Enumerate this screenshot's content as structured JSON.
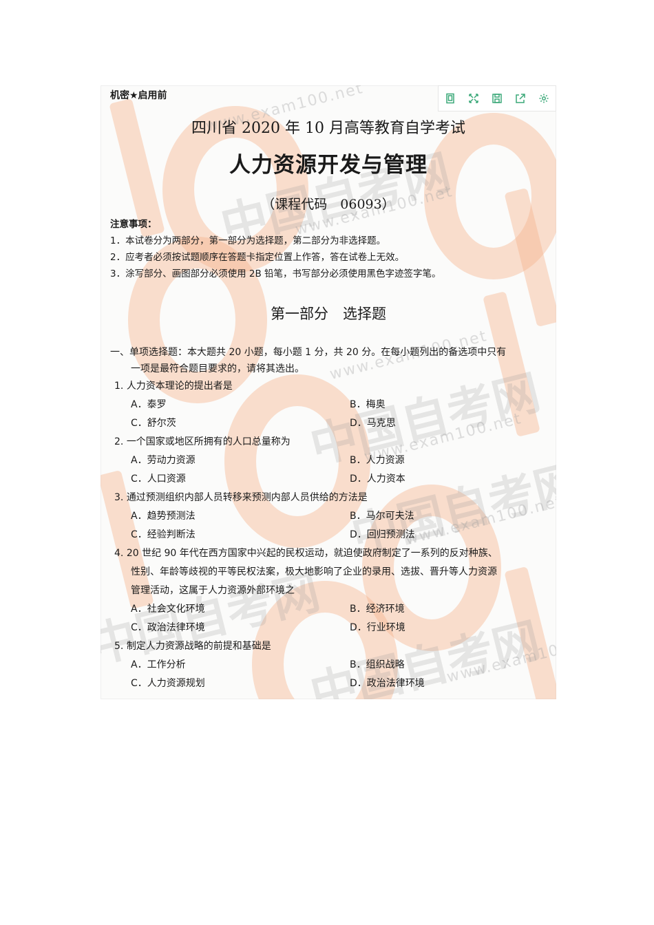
{
  "header": {
    "secret_mark": "机密★启用前",
    "exam_title": "四川省 2020 年 10 月高等教育自学考试",
    "course_name": "人力资源开发与管理",
    "course_code": "（课程代码　06093）"
  },
  "toolbar": {
    "icons": [
      "page-icon",
      "fullscreen-icon",
      "save-icon",
      "share-icon",
      "settings-icon"
    ],
    "accent": "#3aa878"
  },
  "notes": {
    "heading": "注意事项：",
    "items": [
      "1．本试卷分为两部分，第一部分为选择题，第二部分为非选择题。",
      "2．应考者必须按试题顺序在答题卡指定位置上作答，答在试卷上无效。",
      "3．涂写部分、画图部分必须使用 2B 铅笔，书写部分必须使用黑色字迹签字笔。"
    ]
  },
  "part_title": "第一部分　选择题",
  "section": {
    "line1": "一、单项选择题：本大题共 20 小题，每小题 1 分，共 20 分。在每小题列出的备选项中只有",
    "line2": "一项是最符合题目要求的，请将其选出。"
  },
  "questions": [
    {
      "num": "1.",
      "stem": "人力资本理论的提出者是",
      "A": "A．泰罗",
      "B": "B．梅奥",
      "C": "C．舒尔茨",
      "D": "D．马克思"
    },
    {
      "num": "2.",
      "stem": "一个国家或地区所拥有的人口总量称为",
      "A": "A．劳动力资源",
      "B": "B．人力资源",
      "C": "C．人口资源",
      "D": "D．人力资本"
    },
    {
      "num": "3.",
      "stem": "通过预测组织内部人员转移来预测内部人员供给的方法是",
      "A": "A．趋势预测法",
      "B": "B．马尔可夫法",
      "C": "C．经验判断法",
      "D": "D．回归预测法"
    },
    {
      "num": "4.",
      "stem_l1": "20 世纪 90 年代在西方国家中兴起的民权运动，就迫使政府制定了一系列的反对种族、",
      "stem_l2": "性别、年龄等歧视的平等民权法案，极大地影响了企业的录用、选拔、晋升等人力资源",
      "stem_l3": "管理活动，这属于人力资源外部环境之",
      "A": "A．社会文化环境",
      "B": "B．经济环境",
      "C": "C．政治法律环境",
      "D": "D．行业环境"
    },
    {
      "num": "5.",
      "stem": "制定人力资源战略的前提和基础是",
      "A": "A．工作分析",
      "B": "B．组织战略",
      "C": "C．人力资源规划",
      "D": "D．政治法律环境"
    }
  ],
  "watermark": {
    "url_text": "www.exam100.net",
    "brand_text": "中国自考网",
    "color": "#f5b28c"
  }
}
